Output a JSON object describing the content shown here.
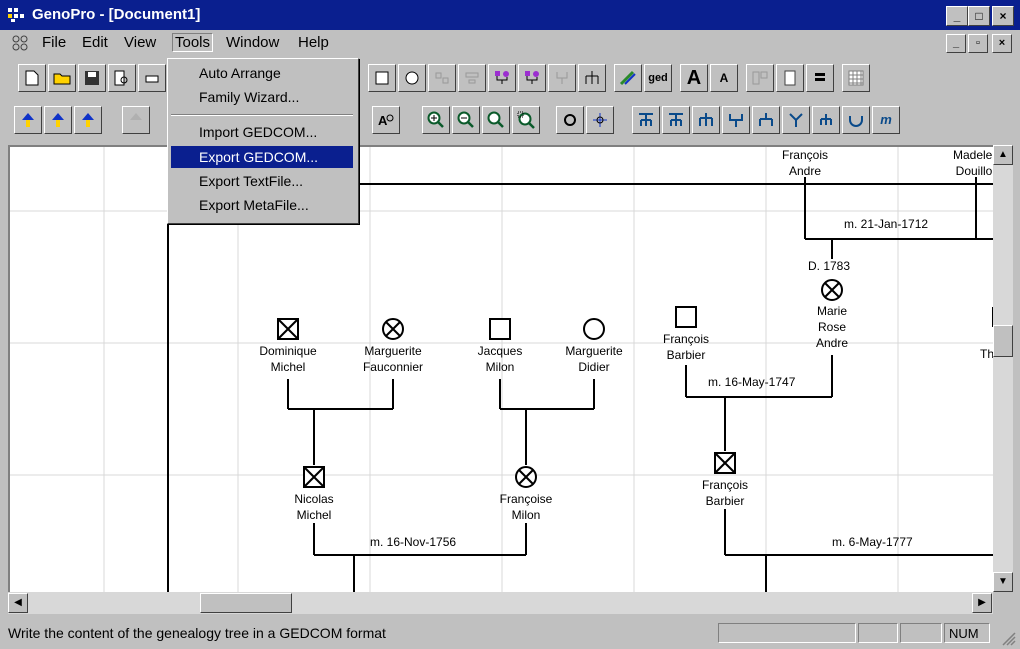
{
  "window": {
    "title": "GenoPro - [Document1]",
    "min": "_",
    "max": "□",
    "close": "×"
  },
  "menubar": {
    "items": [
      "File",
      "Edit",
      "View",
      "Tools",
      "Window",
      "Help"
    ]
  },
  "tools_menu": {
    "items": [
      "Auto Arrange",
      "Family Wizard...",
      "Import GEDCOM...",
      "Export GEDCOM...",
      "Export TextFile...",
      "Export MetaFile..."
    ],
    "selected": "Export GEDCOM..."
  },
  "toolbar2": {
    "ged_label": "ged",
    "font_big": "A",
    "font_small": "A",
    "m_label": "m"
  },
  "tree": {
    "people": [
      {
        "name1": "François",
        "name2": "Andre"
      },
      {
        "name1": "Madelei",
        "name2": "Douillo"
      },
      {
        "name1": "Dominique",
        "name2": "Michel"
      },
      {
        "name1": "Marguerite",
        "name2": "Fauconnier"
      },
      {
        "name1": "Jacques",
        "name2": "Milon"
      },
      {
        "name1": "Marguerite",
        "name2": "Didier"
      },
      {
        "name1": "François",
        "name2": "Barbier"
      },
      {
        "name1": "Marie",
        "name2": "Rose",
        "name3": "Andre"
      },
      {
        "name1": "Nicolas",
        "name2": "Michel"
      },
      {
        "name1": "Françoise",
        "name2": "Milon"
      },
      {
        "name1": "François",
        "name2": "Barbier"
      }
    ],
    "death_label": "D. 1783",
    "marriages": [
      "m. 21-Jan-1712",
      "m. 16-May-1747",
      "m. 16-Nov-1756",
      "m. 6-May-1777"
    ],
    "cut_label": "Th"
  },
  "statusbar": {
    "text": "Write the content of the genealogy tree in a GEDCOM format",
    "num": "NUM"
  }
}
